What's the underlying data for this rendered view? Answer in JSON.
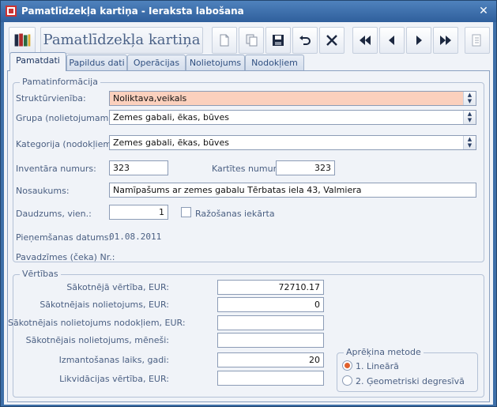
{
  "window": {
    "title": "Pamatlīdzekļa kartiņa - Ieraksta labošana",
    "close_glyph": "✕"
  },
  "toolbar": {
    "title": "Pamatlīdzekļa kartiņa"
  },
  "tabs": [
    {
      "label": "Pamatdati"
    },
    {
      "label": "Papildus dati"
    },
    {
      "label": "Operācijas"
    },
    {
      "label": "Nolietojums"
    },
    {
      "label": "Nodokļiem"
    }
  ],
  "main_info": {
    "legend": "Pamatinformācija",
    "struct_label": "Struktūrvienība:",
    "struct_value": "Noliktava,veikals",
    "group_label": "Grupa (nolietojumam):",
    "group_value": "Zemes gabali, ēkas, būves",
    "category_label": "Kategorija (nodokļiem):",
    "category_value": "Zemes gabali, ēkas, būves",
    "inventory_label": "Inventāra numurs:",
    "inventory_value": "323",
    "card_label": "Kartītes numurs:",
    "card_value": "323",
    "name_label": "Nosaukums:",
    "name_value": "Namīpašums ar zemes gabalu  Tērbatas iela 43, Valmiera",
    "qty_label": "Daudzums, vien.:",
    "qty_value": "1",
    "production_label": "Ražošanas iekārta",
    "accept_date_label": "Pieņemšanas datums:",
    "accept_date_value": "01.08.2011",
    "invoice_label": "Pavadzīmes (čeka) Nr.:"
  },
  "values": {
    "legend": "Vērtības",
    "initial_value_label": "Sākotnējā vērtība, EUR:",
    "initial_value": "72710.17",
    "initial_depr_label": "Sākotnējais nolietojums, EUR:",
    "initial_depr": "0",
    "initial_depr_tax_label": "Sākotnējais nolietojums nodokļiem, EUR:",
    "initial_depr_tax": "",
    "initial_depr_months_label": "Sākotnējais nolietojums, mēneši:",
    "initial_depr_months": "",
    "lifetime_label": "Izmantošanas laiks, gadi:",
    "lifetime": "20",
    "liquidation_label": "Likvidācijas vērtība, EUR:",
    "liquidation": ""
  },
  "method": {
    "legend": "Aprēķina metode",
    "option1": "1. Lineārā",
    "option2": "2. Ģeometriski degresīvā",
    "selected": 1
  }
}
